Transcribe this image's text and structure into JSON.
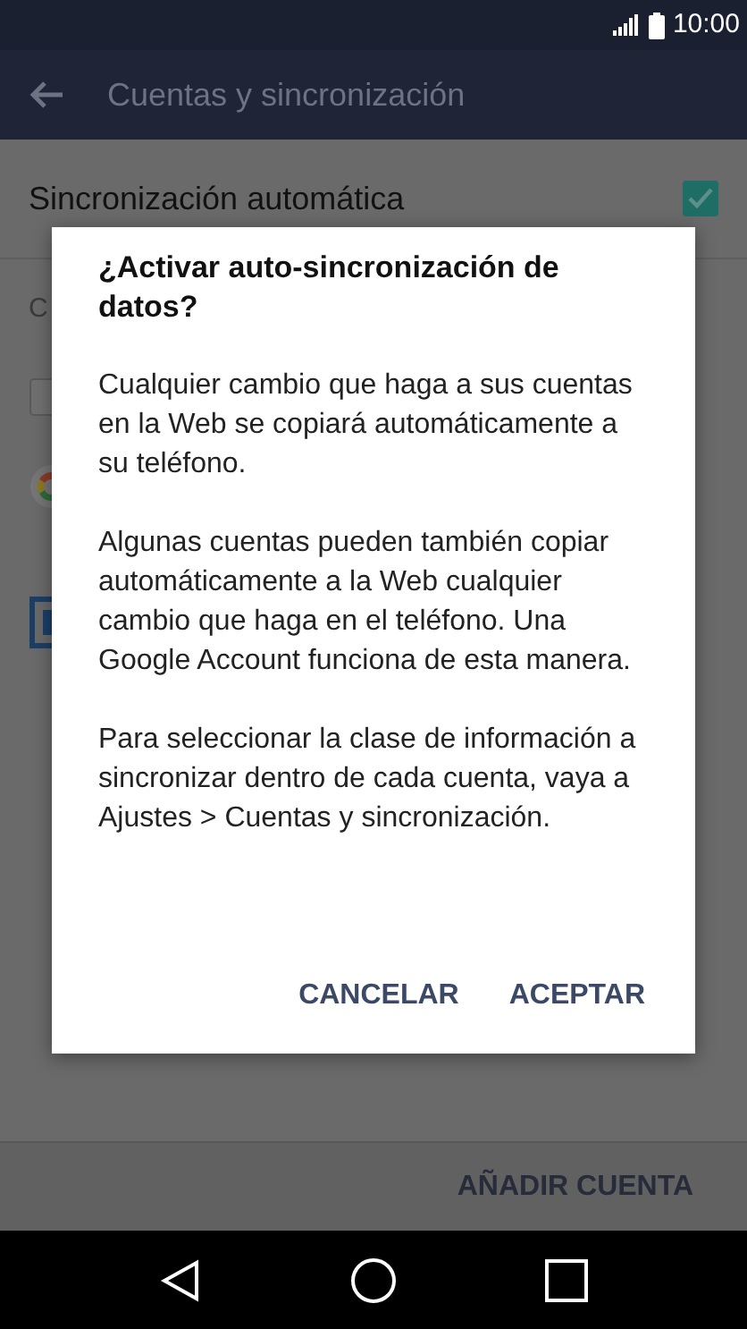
{
  "status_bar": {
    "time": "10:00"
  },
  "app_bar": {
    "title": "Cuentas y sincronización"
  },
  "settings": {
    "auto_sync": {
      "label": "Sincronización automática",
      "checked": true
    },
    "section_header": "C"
  },
  "footer": {
    "button": "AÑADIR CUENTA"
  },
  "dialog": {
    "title": "¿Activar auto-sincronización de datos?",
    "paragraphs": [
      "Cualquier cambio que haga a sus cuentas en la Web se copiará automáticamente a su teléfono.",
      "Algunas cuentas pueden también copiar automáticamente a la Web cualquier cambio que haga en el teléfono. Una Google Account funciona de esta manera.",
      "Para seleccionar la clase de información a sincronizar dentro de cada cuenta, vaya a Ajustes > Cuentas y sincronización."
    ],
    "buttons": [
      "CANCELAR",
      "ACEPTAR"
    ]
  }
}
